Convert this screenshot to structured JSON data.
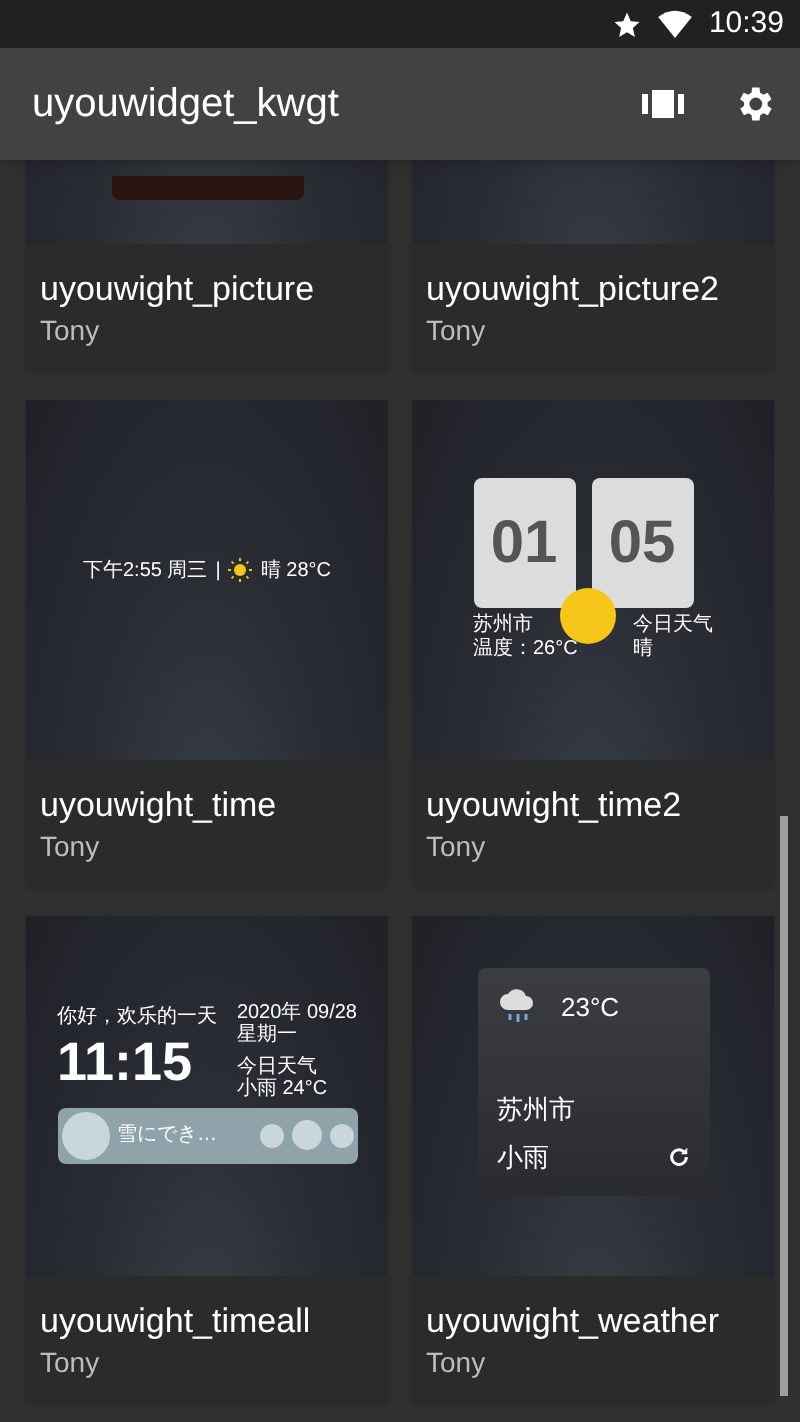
{
  "status_bar": {
    "time": "10:39"
  },
  "app_bar": {
    "title": "uyouwidget_kwgt"
  },
  "rows": [
    {
      "widgets": [
        {
          "preview": {
            "kind": "picture"
          },
          "title": "uyouwight_picture",
          "author": "Tony"
        },
        {
          "preview": {
            "kind": "blank"
          },
          "title": "uyouwight_picture2",
          "author": "Tony"
        }
      ]
    },
    {
      "widgets": [
        {
          "preview": {
            "kind": "time_line",
            "time": "下午2:55 周三",
            "separator": "|",
            "weather": "晴 28°C"
          },
          "title": "uyouwight_time",
          "author": "Tony"
        },
        {
          "preview": {
            "kind": "flip_clock",
            "hours": "01",
            "minutes": "05",
            "city": "苏州市",
            "temperature": "温度：26°C",
            "label": "今日天气",
            "condition": "晴"
          },
          "title": "uyouwight_time2",
          "author": "Tony"
        }
      ]
    },
    {
      "widgets": [
        {
          "preview": {
            "kind": "time_all",
            "greeting": "你好，欢乐的一天",
            "date": "2020年 09/28",
            "weekday": "星期一",
            "time": "11:15",
            "label": "今日天气",
            "weather": "小雨 24°C",
            "song": "雪にでき…"
          },
          "title": "uyouwight_timeall",
          "author": "Tony"
        },
        {
          "preview": {
            "kind": "weather",
            "temperature": "23°C",
            "city": "苏州市",
            "condition": "小雨"
          },
          "title": "uyouwight_weather",
          "author": "Tony"
        }
      ]
    }
  ]
}
